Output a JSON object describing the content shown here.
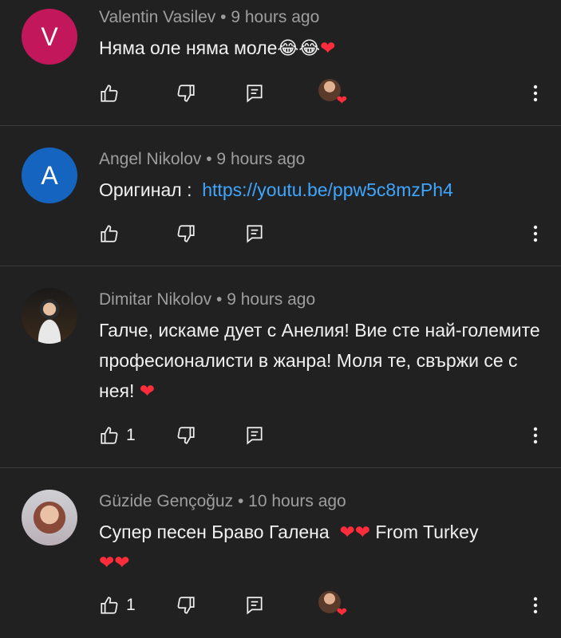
{
  "comments": [
    {
      "author": "Valentin Vasilev",
      "time": "• 9 hours ago",
      "avatar_letter": "V",
      "avatar_color": "#c2185b",
      "text_main": "Няма оле няма моле",
      "emojis": "😂😂",
      "heart": "❤",
      "like_count": "",
      "creator_hearted": true
    },
    {
      "author": "Angel Nikolov",
      "time": "• 9 hours ago",
      "avatar_letter": "A",
      "avatar_color": "#1565c0",
      "text_main": "Оригинал : ",
      "link": "https://youtu.be/ppw5c8mzPh4",
      "like_count": "",
      "creator_hearted": false
    },
    {
      "author": "Dimitar Nikolov",
      "time": "• 9 hours ago",
      "text_main": "Галче, искаме дует с Анелия! Вие сте най-големите професионалисти в жанра! Моля те, свържи се с нея! ",
      "heart": "❤",
      "like_count": "1",
      "creator_hearted": false
    },
    {
      "author": "Güzide Gençoğuz",
      "time": "• 10 hours ago",
      "text_before": "Супер песен Браво Галена  ",
      "hearts_mid": "❤❤",
      "text_after": " From Turkey",
      "hearts_end": "❤❤",
      "like_count": "1",
      "creator_hearted": true
    }
  ],
  "colors": {
    "background": "#212121",
    "meta_text": "#9e9e9e",
    "link": "#3ea6ff",
    "heart": "#ff2d3b"
  },
  "icons": {
    "like": "thumb-up-icon",
    "dislike": "thumb-down-icon",
    "reply": "reply-icon",
    "more": "more-vert-icon",
    "creator_heart": "creator-heart-icon"
  },
  "glyphs": {
    "creator_heart": "❤"
  }
}
